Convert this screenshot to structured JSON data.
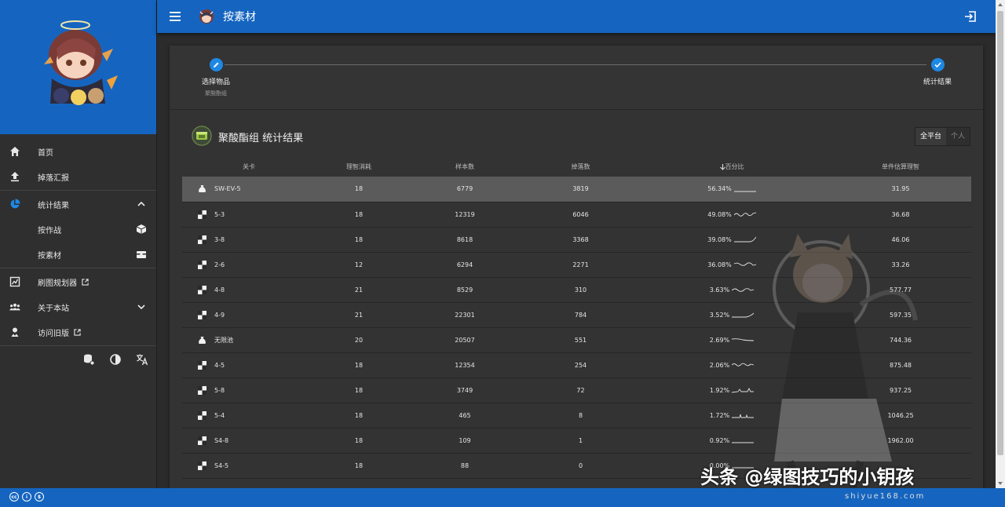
{
  "app": {
    "title": "按素材"
  },
  "sidebar": {
    "items": [
      {
        "label": "首页",
        "icon": "home-icon"
      },
      {
        "label": "掉落汇报",
        "icon": "upload-icon"
      },
      {
        "label": "统计结果",
        "icon": "pie-chart-icon"
      },
      {
        "label": "按作战",
        "icon": "cube-icon"
      },
      {
        "label": "按素材",
        "icon": "box-icon"
      },
      {
        "label": "刷图规划器",
        "icon": "planner-icon"
      },
      {
        "label": "关于本站",
        "icon": "people-icon"
      },
      {
        "label": "访问旧版",
        "icon": "legacy-icon"
      }
    ]
  },
  "stepper": {
    "step1_label": "选择物品",
    "step1_sub": "聚酸酯组",
    "step2_label": "统计结果"
  },
  "results": {
    "title": "聚酸酯组 统计结果",
    "toggle_all": "全平台",
    "toggle_personal": "个人"
  },
  "table": {
    "headers": [
      "关卡",
      "理智消耗",
      "样本数",
      "掉落数",
      "百分比",
      "单件估算理智"
    ],
    "rows": [
      {
        "stage": "SW-EV-5",
        "type": "event",
        "sanity": "18",
        "samples": "6779",
        "drops": "3819",
        "pct": "56.34%",
        "cost": "31.95"
      },
      {
        "stage": "5-3",
        "type": "main",
        "sanity": "18",
        "samples": "12319",
        "drops": "6046",
        "pct": "49.08%",
        "cost": "36.68"
      },
      {
        "stage": "3-8",
        "type": "main",
        "sanity": "18",
        "samples": "8618",
        "drops": "3368",
        "pct": "39.08%",
        "cost": "46.06"
      },
      {
        "stage": "2-6",
        "type": "main",
        "sanity": "12",
        "samples": "6294",
        "drops": "2271",
        "pct": "36.08%",
        "cost": "33.26"
      },
      {
        "stage": "4-8",
        "type": "main",
        "sanity": "21",
        "samples": "8529",
        "drops": "310",
        "pct": "3.63%",
        "cost": "577.77"
      },
      {
        "stage": "4-9",
        "type": "main",
        "sanity": "21",
        "samples": "22301",
        "drops": "784",
        "pct": "3.52%",
        "cost": "597.35"
      },
      {
        "stage": "无限池",
        "type": "event",
        "sanity": "20",
        "samples": "20507",
        "drops": "551",
        "pct": "2.69%",
        "cost": "744.36"
      },
      {
        "stage": "4-5",
        "type": "main",
        "sanity": "18",
        "samples": "12354",
        "drops": "254",
        "pct": "2.06%",
        "cost": "875.48"
      },
      {
        "stage": "5-8",
        "type": "main",
        "sanity": "18",
        "samples": "3749",
        "drops": "72",
        "pct": "1.92%",
        "cost": "937.25"
      },
      {
        "stage": "5-4",
        "type": "main",
        "sanity": "18",
        "samples": "465",
        "drops": "8",
        "pct": "1.72%",
        "cost": "1046.25"
      },
      {
        "stage": "S4-8",
        "type": "main",
        "sanity": "18",
        "samples": "109",
        "drops": "1",
        "pct": "0.92%",
        "cost": "1962.00"
      },
      {
        "stage": "S4-5",
        "type": "main",
        "sanity": "18",
        "samples": "88",
        "drops": "0",
        "pct": "0.00%",
        "cost": ""
      }
    ]
  },
  "overlay": {
    "watermark": "头条 @绿图技巧的小钥孩",
    "watermark_sub": "shiyue168.com"
  },
  "colors": {
    "primary": "#1565c0",
    "accent": "#1e88e5",
    "surface": "#333333"
  }
}
